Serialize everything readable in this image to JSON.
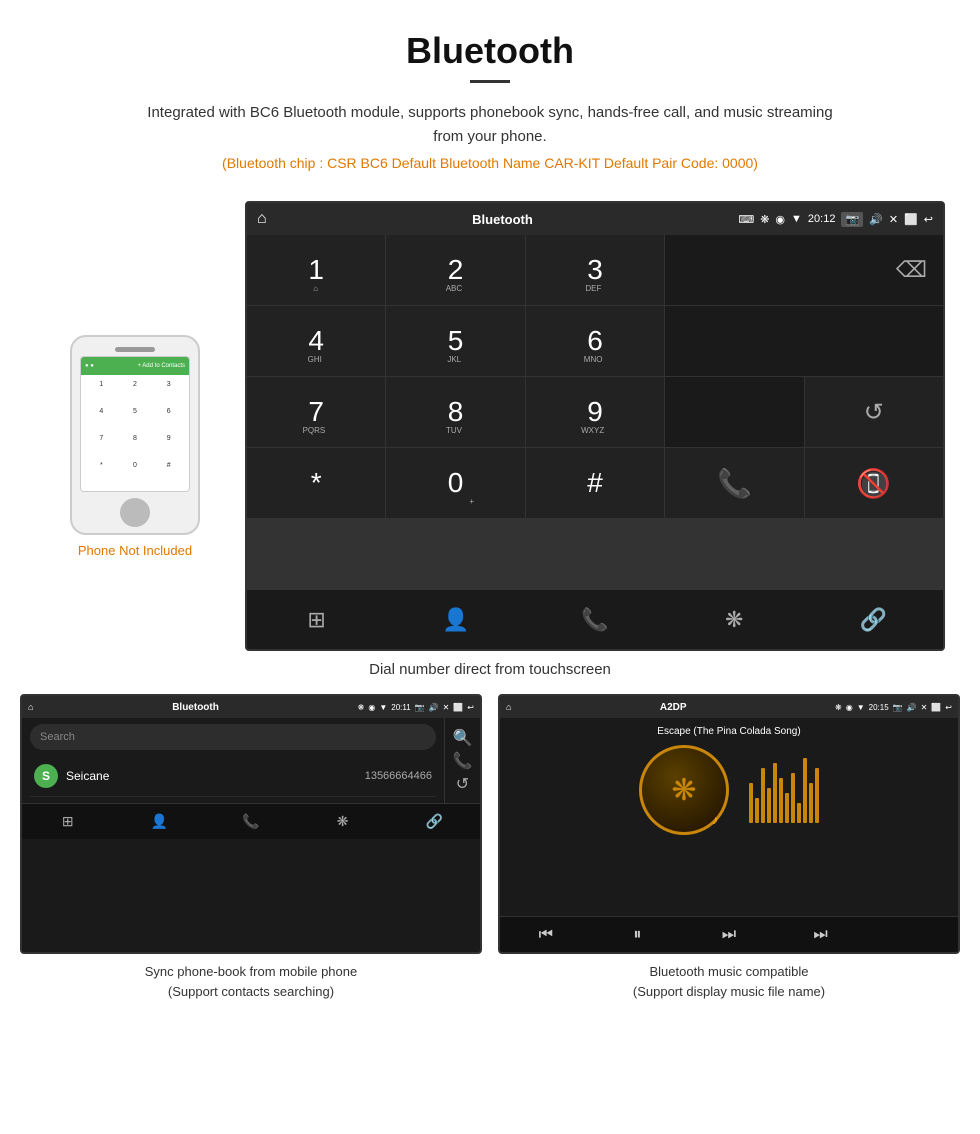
{
  "header": {
    "title": "Bluetooth",
    "description": "Integrated with BC6 Bluetooth module, supports phonebook sync, hands-free call, and music streaming from your phone.",
    "info_line": "(Bluetooth chip : CSR BC6    Default Bluetooth Name CAR-KIT    Default Pair Code: 0000)"
  },
  "main_screen": {
    "statusbar": {
      "title": "Bluetooth",
      "time": "20:12",
      "usb_icon": "⌨"
    },
    "dial_keys": [
      {
        "num": "1",
        "sub": "⌂"
      },
      {
        "num": "2",
        "sub": "ABC"
      },
      {
        "num": "3",
        "sub": "DEF"
      },
      {
        "num": "4",
        "sub": "GHI"
      },
      {
        "num": "5",
        "sub": "JKL"
      },
      {
        "num": "6",
        "sub": "MNO"
      },
      {
        "num": "7",
        "sub": "PQRS"
      },
      {
        "num": "8",
        "sub": "TUV"
      },
      {
        "num": "9",
        "sub": "WXYZ"
      },
      {
        "num": "*",
        "sub": ""
      },
      {
        "num": "0",
        "sub": "+"
      },
      {
        "num": "#",
        "sub": ""
      }
    ],
    "caption": "Dial number direct from touchscreen"
  },
  "phone_aside": {
    "not_included": "Phone Not Included"
  },
  "bottom_left": {
    "title": "Bluetooth",
    "time": "20:11",
    "search_placeholder": "Search",
    "contact": {
      "initial": "S",
      "name": "Seicane",
      "number": "13566664466"
    },
    "caption_line1": "Sync phone-book from mobile phone",
    "caption_line2": "(Support contacts searching)"
  },
  "bottom_right": {
    "title": "A2DP",
    "time": "20:15",
    "song": "Escape (The Pina Colada Song)",
    "caption_line1": "Bluetooth music compatible",
    "caption_line2": "(Support display music file name)"
  },
  "icons": {
    "home": "⌂",
    "bluetooth": "❋",
    "call": "📞",
    "end_call": "📵",
    "refresh": "↺",
    "grid": "⊞",
    "person": "👤",
    "link": "🔗",
    "back_delete": "⌫",
    "search": "🔍",
    "back_arrow": "↩",
    "skip_back": "⏮",
    "play_pause": "⏭",
    "skip_fwd": "⏭",
    "skip_end": "⏭"
  }
}
